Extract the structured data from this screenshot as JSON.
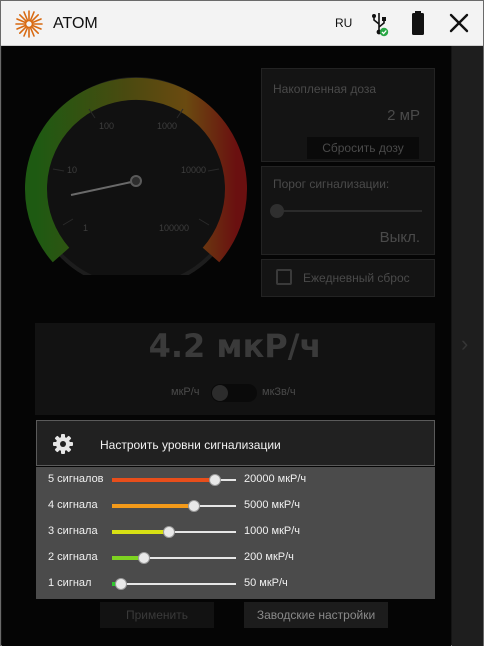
{
  "app": {
    "title": "ATOM",
    "language": "RU",
    "icons": [
      "atom-logo-icon",
      "usb-icon",
      "battery-icon",
      "close-icon"
    ]
  },
  "gauge": {
    "ticks": [
      "1",
      "10",
      "100",
      "1000",
      "10000",
      "100000"
    ],
    "needle_value": 4.2
  },
  "dose": {
    "label": "Накопленная доза",
    "value": "2 мР",
    "reset_button": "Сбросить дозу"
  },
  "alarm": {
    "label": "Порог сигнализации:",
    "value": "Выкл."
  },
  "daily_reset": {
    "label": "Ежедневный сброс",
    "checked": false
  },
  "reading": {
    "value": "4.2 мкР/ч",
    "unit_left": "мкР/ч",
    "unit_right": "мкЗв/ч"
  },
  "signal_popup": {
    "title": "Настроить уровни сигнализации",
    "levels": [
      {
        "label": "5 сигналов",
        "value": "20000 мкР/ч",
        "position": 0.83,
        "color": "#e84e1b"
      },
      {
        "label": "4 сигнала",
        "value": "5000 мкР/ч",
        "position": 0.66,
        "color": "#f39a1a"
      },
      {
        "label": "3 сигнала",
        "value": "1000 мкР/ч",
        "position": 0.46,
        "color": "#d8e014"
      },
      {
        "label": "2 сигнала",
        "value": "200 мкР/ч",
        "position": 0.26,
        "color": "#7ed321"
      },
      {
        "label": "1 сигнал",
        "value": "50 мкР/ч",
        "position": 0.07,
        "color": "#2ec72e"
      }
    ]
  },
  "footer": {
    "apply_button": "Применить",
    "factory_button": "Заводские настройки"
  }
}
